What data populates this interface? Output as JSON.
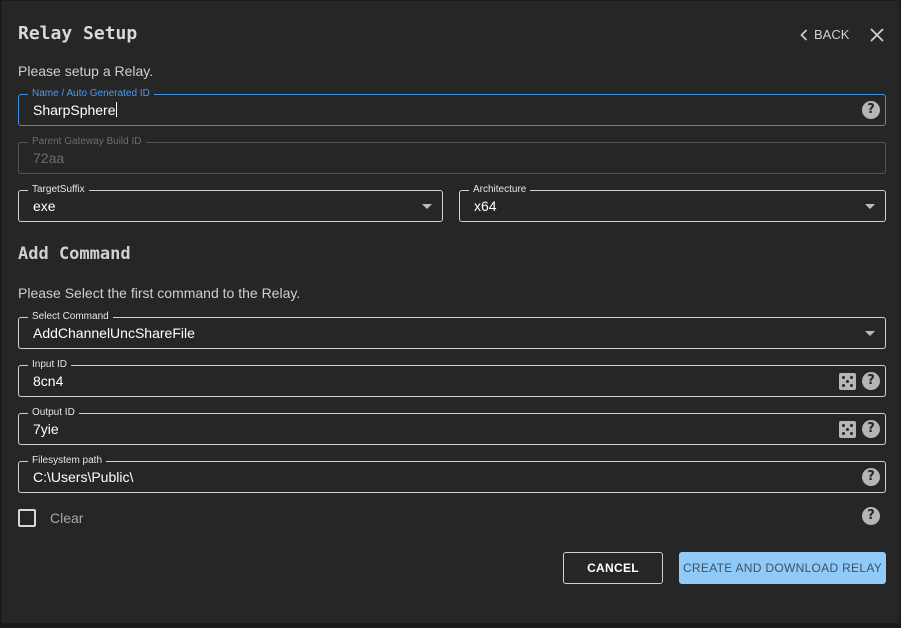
{
  "header": {
    "title": "Relay Setup",
    "back_label": "BACK"
  },
  "setup": {
    "subtitle": "Please setup a Relay.",
    "name_field": {
      "label": "Name / Auto Generated ID",
      "value": "SharpSphere"
    },
    "parent_field": {
      "label": "Parent Gateway Build ID",
      "value": "72aa"
    },
    "target_suffix": {
      "label": "TargetSuffix",
      "value": "exe"
    },
    "architecture": {
      "label": "Architecture",
      "value": "x64"
    }
  },
  "command": {
    "section_title": "Add Command",
    "subtitle": "Please Select the first command to the Relay.",
    "select_command": {
      "label": "Select Command",
      "value": "AddChannelUncShareFile"
    },
    "input_id": {
      "label": "Input ID",
      "value": "8cn4"
    },
    "output_id": {
      "label": "Output ID",
      "value": "7yie"
    },
    "filesystem_path": {
      "label": "Filesystem path",
      "value": "C:\\Users\\Public\\"
    },
    "clear": {
      "label": "Clear",
      "checked": false
    }
  },
  "actions": {
    "cancel_label": "CANCEL",
    "create_label": "CREATE AND DOWNLOAD RELAY"
  },
  "colors": {
    "background": "#262626",
    "focus": "#3d8fe0",
    "primary_button": "#90caf9"
  },
  "icons": [
    "chevron-left-icon",
    "close-icon",
    "help-icon",
    "dice-icon",
    "dropdown-arrow-icon"
  ]
}
